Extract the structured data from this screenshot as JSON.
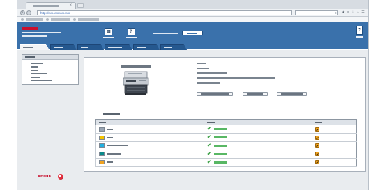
{
  "browser": {
    "tab_close_glyph": "×",
    "url": "http://xxx.xxx.xxx.xxx",
    "back_glyph": "‹",
    "forward_glyph": "›",
    "search_glyph": "⌕",
    "toolbar_icons": [
      "star-icon",
      "list-icon",
      "download-icon",
      "home-icon",
      "menu-icon"
    ]
  },
  "header": {
    "brand_color": "#c8102e",
    "bar_color": "#3a71ab",
    "help_glyph": "?"
  },
  "nav": {
    "tab_count": 6,
    "active_tab_index": 0
  },
  "supplies": {
    "rows": [
      {
        "swatch_color": "#9aa5b3",
        "status": "ok"
      },
      {
        "swatch_color": "#f5c400",
        "status": "ok"
      },
      {
        "swatch_color": "#22b0e0",
        "status": "ok"
      },
      {
        "swatch_color": "#0a8a8a",
        "status": "ok"
      },
      {
        "swatch_color": "#f0a321",
        "status": "ok"
      }
    ]
  },
  "footer": {
    "brand": "xerox"
  },
  "colors": {
    "status_ok": "#58b764",
    "tool_icon": "#f0a321"
  }
}
